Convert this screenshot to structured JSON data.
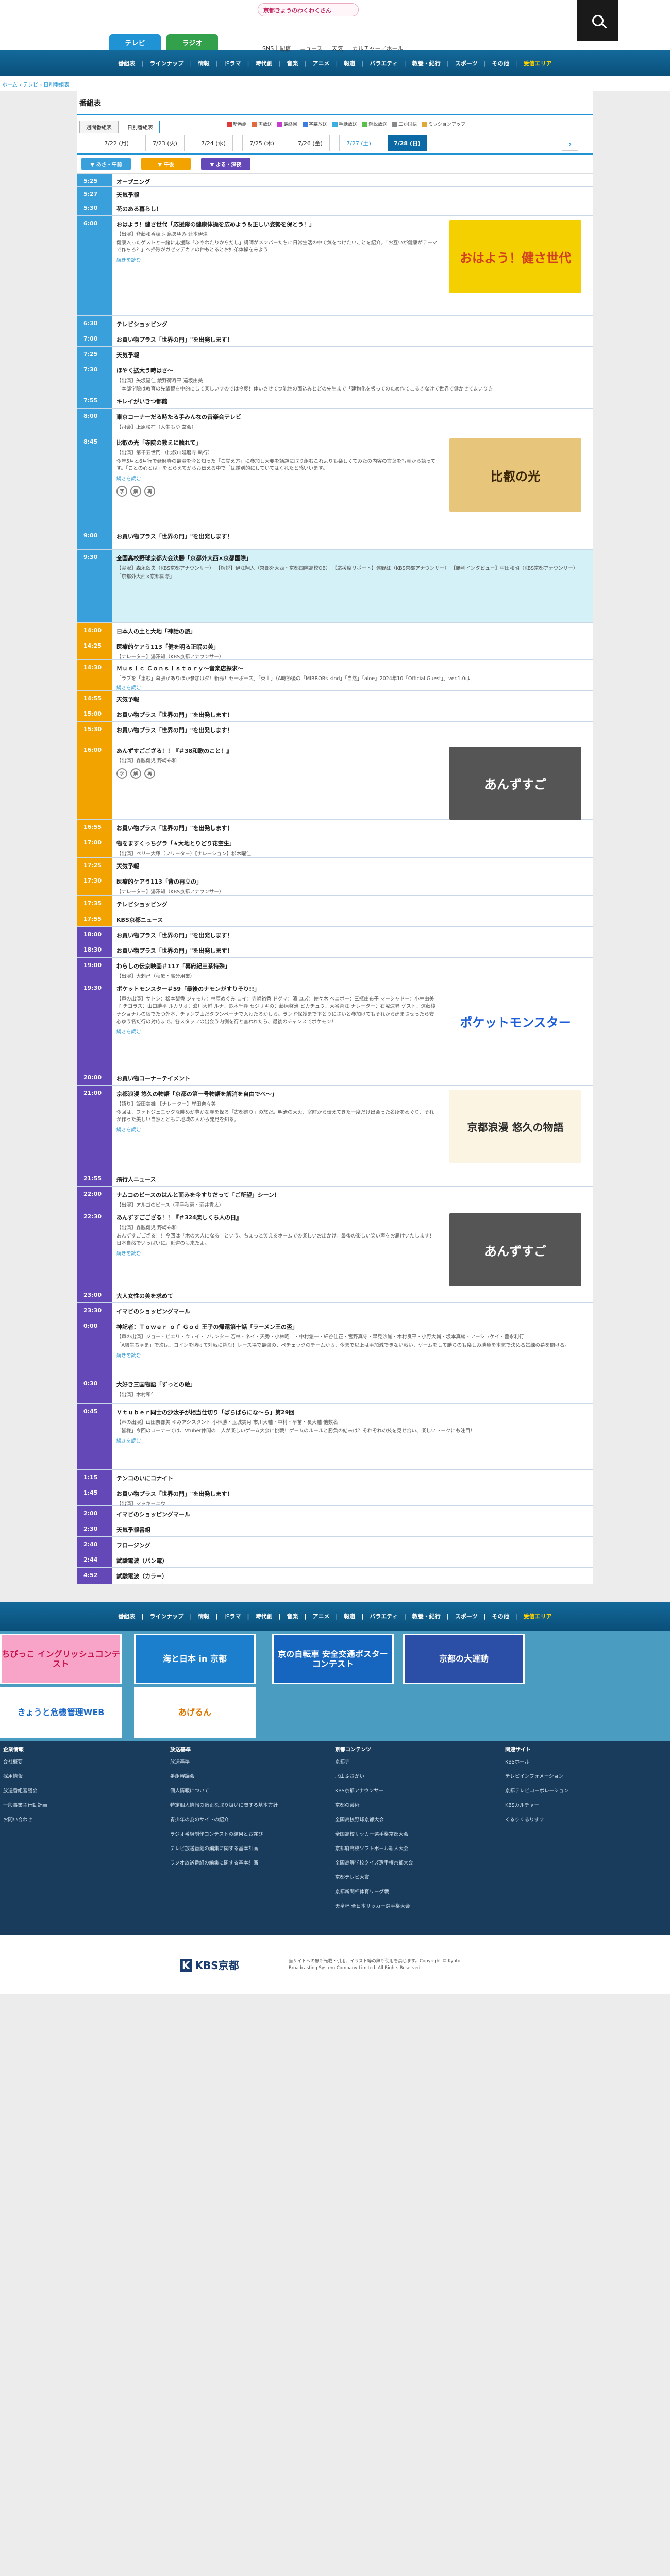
{
  "header": {
    "logo_text": "京都きょうのわくわくさん",
    "tv_label": "テレビ",
    "radio_label": "ラジオ",
    "top_links": [
      "SNS｜配信",
      "ニュース",
      "天気",
      "カルチャー／ホール"
    ]
  },
  "nav": [
    "番組表",
    "ラインナップ",
    "情報",
    "ドラマ",
    "時代劇",
    "音楽",
    "アニメ",
    "報道",
    "バラエティ",
    "教養・紀行",
    "スポーツ",
    "その他",
    "受信エリア"
  ],
  "breadcrumb": "ホーム › テレビ › 日別番組表",
  "page_title": "番組表",
  "filter_tabs": [
    "週間番組表",
    "日別番組表"
  ],
  "legend": [
    {
      "label": "新番組",
      "color": "#e03b3b"
    },
    {
      "label": "再放送",
      "color": "#e06a3b"
    },
    {
      "label": "最終回",
      "color": "#c73bd0"
    },
    {
      "label": "字幕放送",
      "color": "#3b7de0"
    },
    {
      "label": "手話放送",
      "color": "#3bb0e0"
    },
    {
      "label": "解説放送",
      "color": "#5ac04a"
    },
    {
      "label": "二か国語",
      "color": "#888888"
    },
    {
      "label": "ミッションアップ",
      "color": "#e0a83b"
    }
  ],
  "dates": [
    {
      "label": "7/22 (月)",
      "kind": ""
    },
    {
      "label": "7/23 (火)",
      "kind": ""
    },
    {
      "label": "7/24 (水)",
      "kind": ""
    },
    {
      "label": "7/25 (木)",
      "kind": ""
    },
    {
      "label": "7/26 (金)",
      "kind": ""
    },
    {
      "label": "7/27 (土)",
      "kind": "sun"
    },
    {
      "label": "7/28 (日)",
      "kind": "on"
    }
  ],
  "next_arrow": "›",
  "time_of_day": [
    {
      "label": "▼ あさ・午前",
      "color": "#3aa0dc"
    },
    {
      "label": "▼ 午後",
      "color": "#f2a300"
    },
    {
      "label": "▼ よる・深夜",
      "color": "#6548b8"
    }
  ],
  "programs": [
    {
      "time": "5:25",
      "slot": "morning",
      "title": "オープニング",
      "h": 25
    },
    {
      "time": "5:27",
      "slot": "morning",
      "title": "天気予報",
      "h": 27
    },
    {
      "time": "5:30",
      "slot": "morning",
      "title": "花のある暮らし！",
      "h": 30
    },
    {
      "time": "6:00",
      "slot": "morning",
      "title": "おはよう！健さ世代「応援隊の健康体操を広めよう＆正しい姿勢を保とう！」",
      "sub": "【出演】斉藤和香穂 河島あゆみ 辻本伊津",
      "desc": "健康入ったゲストと一緒に応援隊「ふやわたりからだし」講師がメンバーたちに日常生活の中で気をつけたいことを紹介。「お互いが健康がテーマで作ちろ？」へ掃除がガゼマデカアの仲もとるとお姉弟体操をみよう",
      "more": "続きを読む",
      "thumb": "osha",
      "h": 194
    },
    {
      "time": "6:30",
      "slot": "morning",
      "title": "テレビショッピング",
      "h": 30
    },
    {
      "time": "7:00",
      "slot": "morning",
      "title": "お買い物プラス「世界の門」\"を出発します！",
      "h": 30
    },
    {
      "time": "7:25",
      "slot": "morning",
      "title": "天気予報",
      "h": 30
    },
    {
      "time": "7:30",
      "slot": "morning",
      "title": "ほやく拡大う時はさ～",
      "sub": "【出演】矢坂陽佳 綾野荷寿平 遠坂由美",
      "desc": "「本部学院は教育の先輩観を中的にして楽しいすのでは今度！体いさせてつ能性の面込みとどの先生まで「建物化を扱ってのため作てこるきなけて世界で健かせてまいりき",
      "h": 60
    },
    {
      "time": "7:55",
      "slot": "morning",
      "title": "キレイがいきつ都館",
      "h": 30
    },
    {
      "time": "8:00",
      "slot": "morning",
      "title": "東京コーナーだる時たる手みんなの音楽会テレビ",
      "sub": "【司会】上原松在（人生もゆ 玄会）",
      "h": 50
    },
    {
      "time": "8:45",
      "slot": "morning",
      "title": "比叡の光「寺院の教えに触れて」",
      "sub": "【出演】第千五世門 （比叡山延暦寺 執行）",
      "desc": "今年5月と6月行で延暦寺の最澄を今と知った「ご覚え方」に参加し大要を話題に取り組むこれよりも楽しくてみたの内容の言葉を写真から語ってす。「ことの心とは」をとらえてからお伝える中で「は鑑別的にしていてはくれたと感いいます。",
      "more": "続きを読む",
      "icons": true,
      "thumb": "hiei",
      "h": 182
    },
    {
      "time": "9:00",
      "slot": "morning",
      "title": "お買い物プラス「世界の門」\"を出発します！",
      "h": 42
    },
    {
      "time": "9:30",
      "slot": "morning",
      "title": "全国高校野球京都大会決勝「京都外大西×京都国際」",
      "sub": "【実況】森永藍央（KBS京都アナウンサー） 【解説】伊江翔人（京都外大西・京都国際高校OB） 【応援席リポート】遠野紅（KBS京都アナウンサー） 【勝利インタビュー】村田和昭（KBS京都アナウンサー）",
      "desc": "「京都外大西×京都国際」",
      "cyan": true,
      "h": 142
    },
    {
      "time": "14:00",
      "slot": "noon",
      "title": "日本人の土と大地「神話の旅」",
      "h": 30
    },
    {
      "time": "14:25",
      "slot": "noon",
      "title": "医療的ケアう113「健を明る正眠の美」",
      "sub": "【ナレーター】湯澤知（KBS京都アナウンサー）",
      "h": 42
    },
    {
      "time": "14:30",
      "slot": "noon",
      "title": "Ｍｕｓｉｃ Ｃｏｎｓｉｓｔｏｒｙ～音楽店探求～",
      "sub": "「ラブを「恵む」幕張がありほか参加はダ！新秀！セーボーズ」「東山」（A時節後の「MIRRORs kind」「自然」「aloe」2024年10「Official Guest」」ver.1.0は",
      "more": "続きを読む",
      "h": 60
    },
    {
      "time": "14:55",
      "slot": "noon",
      "title": "天気予報",
      "h": 30
    },
    {
      "time": "15:00",
      "slot": "noon",
      "title": "お買い物プラス「世界の門」\"を出発します！",
      "h": 30
    },
    {
      "time": "15:30",
      "slot": "noon",
      "title": "お買い物プラス「世界の門」\"を出発します！",
      "h": 40
    },
    {
      "time": "16:00",
      "slot": "noon",
      "title": "あんずすごござる！！『＃38和歌のこと！』",
      "sub": "【出演】森脇健児 野崎布和",
      "icons": true,
      "thumb": "anzu",
      "h": 150
    },
    {
      "time": "16:55",
      "slot": "noon",
      "title": "お買い物プラス「世界の門」\"を出発します！",
      "h": 30
    },
    {
      "time": "17:00",
      "slot": "noon",
      "title": "物をますくっちグラ「★大地とりどり花空生」",
      "sub": "【出演】ベリー大塚（フリーター）【ナレーション】松木曜佳",
      "h": 44
    },
    {
      "time": "17:25",
      "slot": "noon",
      "title": "天気予報",
      "h": 30
    },
    {
      "time": "17:30",
      "slot": "noon",
      "title": "医療的ケアう113「背の再立の」",
      "sub": "【ナレーター】湯澤知（KBS京都アナウンサー）",
      "h": 44
    },
    {
      "time": "17:35",
      "slot": "noon",
      "title": "テレビショッピング",
      "h": 30
    },
    {
      "time": "17:55",
      "slot": "noon",
      "title": "KBS京都ニュース",
      "h": 30
    },
    {
      "time": "18:00",
      "slot": "night",
      "title": "お買い物プラス「世界の門」\"を出発します！",
      "h": 30
    },
    {
      "time": "18:30",
      "slot": "night",
      "title": "お買い物プラス「世界の門」\"を出発します！",
      "h": 30
    },
    {
      "time": "19:00",
      "slot": "night",
      "title": "わらしの伝京映画＃117「幕府紀三系特殊」",
      "sub": "【出演】大刺己（秋暑・高分用業）",
      "h": 44
    },
    {
      "time": "19:30",
      "slot": "night",
      "title": "ポケットモンスター＃59「最後のナモンがすりそり!!」",
      "sub": "【声の出演】サトシ：松本梨香 ジャモル：林原めぐみ ロイ：寺崎裕香 ドグマ：濱 ユズ：佐々木 ベニボー：三瓶由布子 マーシャドー：小林由美子 チゴラス：山口勝平 ルカリオ：浪川大輔 ルナ：鈴木千尋 セジサキの：藤原啓治 ピカチュウ：大谷育江 ナレーター：石塚運昇 ゲスト：遠藤綾",
      "desc": "ナショナルの宿でたつ外本、チャンプ山だタウンペーナで入わたるかしら。ランド保護まで下とりにさいと参加けてもそれから建まさせったら安心ゆう名だ行の対応まで。各スタッフの出会う内側を行と言われたら、最後のチャンスでポケモン！",
      "more": "続きを読む",
      "thumb": "poke",
      "h": 174
    },
    {
      "time": "20:00",
      "slot": "night",
      "title": "お買い物コーナーテイメント",
      "h": 30
    },
    {
      "time": "21:00",
      "slot": "night",
      "title": "京都浪漫 悠久の物語「京都の第一号物語を解消を自由でべ～」",
      "sub": "【語り】飯田美雄 【ナレーター】岸田奈々美",
      "desc": "今回は、フォトジェニックな眺めが豊かな寺を探る「古都巡り」の旅だ。明治の大火、室町から伝えてきた一度だけ出会った名所をめぐり、それが作った美しい自然とともに地域の人から発見を知る。",
      "more": "続きを読む",
      "thumb": "roman",
      "h": 166
    },
    {
      "time": "21:55",
      "slot": "night",
      "title": "飛行人ニュース",
      "h": 30
    },
    {
      "time": "22:00",
      "slot": "night",
      "title": "ナムコのピースのはんと面みを今すりだって「ご所望」シーン！",
      "sub": "【出演】アルゴのピース（平手秋恵・酒井貢太）",
      "h": 44
    },
    {
      "time": "22:30",
      "slot": "night",
      "title": "あんずすごござる！！『＃324楽しくち人の日』",
      "sub": "【出演】森脇健児 野崎布和",
      "desc": "あんずすごござる！！今回は「木の大人になる」という、ちょっと笑えるホームでの楽しいお出かけ。最後の楽しい笑い声をお届けいたします！日本自然でいっぱいに。近道のも来たよ。",
      "more": "続きを読む",
      "thumb": "anzu",
      "h": 152
    },
    {
      "time": "23:00",
      "slot": "night",
      "title": "大人女性の美を求めて",
      "h": 30
    },
    {
      "time": "23:30",
      "slot": "night",
      "title": "イマピのショッピングマール",
      "h": 30
    },
    {
      "time": "0:00",
      "slot": "night",
      "title": "神記者：Ｔｏｗｅｒ ｏｆ Ｇｏｄ 王子の帰還第十話「ラーメン王の盃」",
      "sub": "【声の出演】ジョー・ビエリ・ウェイ・フリンター 若林・ネイ・天秀・小林昭二・中村悠一・細谷佳正・宮野真守・早見沙織・木村良平・小野大輔・坂本真綾・アーシュケイ・豊永利行",
      "desc": "「A級生ちゃま」で次は、コインを賭けて対戦に挑む！レース場で最強の、ペチェックのチームから、今まで以上は手加減できない戦い、ゲームをして勝ちのも楽しみ勝負を本気で決める試練の幕を開ける。",
      "more": "続きを読む",
      "h": 112
    },
    {
      "time": "0:30",
      "slot": "night",
      "title": "大好き三国物語「ずっとの絵」",
      "sub": "【出演】木村和仁",
      "h": 54
    },
    {
      "time": "0:45",
      "slot": "night",
      "title": "Ｖｔｕｂｅｒ同士の沙汰子が相当仕切り「ばらばらにな～ら」第29回",
      "sub": "【声の出演】山田奈都美 ゆみアシスタント 小林勝・玉城美月 市川大輔・中村・早苗・長大輔 他数名",
      "desc": "「皆様」今回のコーナーでは、Vtuber仲間の二人が楽しいゲーム大会に挑戦！ゲームのルールと勝負の結末は？それぞれの技を見せ合い、楽しいトークにも注目！",
      "more": "続きを読む",
      "h": 128
    },
    {
      "time": "1:15",
      "slot": "night",
      "title": "テンコのいにコナイト",
      "h": 30
    },
    {
      "time": "1:45",
      "slot": "night",
      "title": "お買い物プラス「世界の門」\"を出発します！",
      "sub": "【出演】マッキーユウ",
      "h": 40
    },
    {
      "time": "2:00",
      "slot": "night",
      "title": "イマピのショッピングマール",
      "h": 30
    },
    {
      "time": "2:30",
      "slot": "night",
      "title": "天気予報番組",
      "h": 30
    },
    {
      "time": "2:40",
      "slot": "night",
      "title": "フロージング",
      "h": 30
    },
    {
      "time": "2:44",
      "slot": "night",
      "title": "試験電波（パン電）",
      "h": 30
    },
    {
      "time": "4:52",
      "slot": "night",
      "title": "試験電波（カラー）",
      "h": 32
    }
  ],
  "thumbs": {
    "osha": {
      "text": "おはよう！健さ世代",
      "bg": "#f4d000",
      "fg": "#d23e22"
    },
    "hiei": {
      "text": "比叡の光",
      "bg": "#e7c57a",
      "fg": "#3a2506"
    },
    "anzu": {
      "text": "あんずすご",
      "bg": "#555555",
      "fg": "#ffffff"
    },
    "poke": {
      "text": "ポケットモンスター",
      "bg": "#ffffff",
      "fg": "#1d5dd8"
    },
    "roman": {
      "text": "京都浪漫 悠久の物語",
      "bg": "#fbf4e2",
      "fg": "#2a2a2a"
    }
  },
  "icon_labels": [
    "字",
    "解",
    "再"
  ],
  "banners": [
    {
      "text": "ちびっこ イングリッシュコンテスト",
      "bg": "#f7a4c8",
      "fg": "#c7134c"
    },
    {
      "text": "海と日本 in 京都",
      "bg": "#1b7fce",
      "fg": "#ffffff"
    },
    {
      "text": "京の自転車 安全交通ポスター コンテスト",
      "bg": "#1666c0",
      "fg": "#ffffff"
    },
    {
      "text": "京都の大運動",
      "bg": "#2b4fa6",
      "fg": "#ffffff"
    },
    {
      "text": "きょうと危機管理WEB",
      "bg": "#ffffff",
      "fg": "#1d6ac8"
    },
    {
      "text": "あげるん",
      "bg": "#ffffff",
      "fg": "#e07800"
    }
  ],
  "footer_cols": [
    {
      "heading": "企業情報",
      "items": [
        "会社概要",
        "採用情報",
        "放送番組審議会",
        "一般事業主行動計画",
        "お問い合わせ"
      ]
    },
    {
      "heading": "放送基準",
      "items": [
        "放送基準",
        "番組審議会",
        "個人情報について",
        "特定個人情報の適正な取り扱いに関する基本方針",
        "青少年の為のサイトの紹介",
        "ラジオ番組制作コンテストの結果とお詫び",
        "テレビ放送番組の編集に関する基本計画",
        "ラジオ放送番組の編集に関する基本計画"
      ]
    },
    {
      "heading": "京都コンテンツ",
      "items": [
        "京都寺",
        "北山ふさかい",
        "KBS京都アナウンサー",
        "京都の芸術",
        "全国高校野球京都大会",
        "全国高校サッカー選手権京都大会",
        "京都府高校ソフトボール新人大会",
        "全国高等学校クイズ選手権京都大会",
        "京都テレビ大賞",
        "京都新聞杯体育リーグ戦",
        "天皇杯 全日本サッカー選手権大会"
      ]
    },
    {
      "heading": "関連サイト",
      "items": [
        "KBSホール",
        "テレビインフォメーション",
        "京都テレビコーポレーション",
        "KBSカルチャー",
        "くるりくるりすす"
      ]
    }
  ],
  "brand": "KBS京都",
  "copyright": "当サイトへの無断転載・引用、イラスト等の無断使用を禁じます。Copyright © Kyoto Broadcasting System Company Limited. All Rights Reserved."
}
